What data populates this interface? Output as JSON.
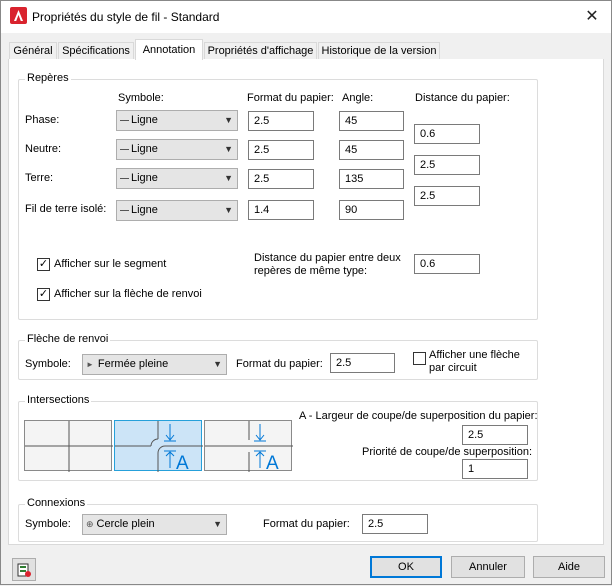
{
  "window": {
    "title": "Propriétés du style de fil - Standard",
    "close_glyph": "✕"
  },
  "tabs": [
    {
      "label": "Général"
    },
    {
      "label": "Spécifications"
    },
    {
      "label": "Annotation"
    },
    {
      "label": "Propriétés d'affichage"
    },
    {
      "label": "Historique de la version"
    }
  ],
  "reperes": {
    "group_label": "Repères",
    "col_symbole": "Symbole:",
    "col_format": "Format du papier:",
    "col_angle": "Angle:",
    "col_distance": "Distance du papier:",
    "rows": [
      {
        "label": "Phase:",
        "symbole": "Ligne",
        "format": "2.5",
        "angle": "45",
        "distance": "0.6"
      },
      {
        "label": "Neutre:",
        "symbole": "Ligne",
        "format": "2.5",
        "angle": "45",
        "distance": "2.5"
      },
      {
        "label": "Terre:",
        "symbole": "Ligne",
        "format": "2.5",
        "angle": "135",
        "distance": "2.5"
      },
      {
        "label": "Fil de terre isolé:",
        "symbole": "Ligne",
        "format": "1.4",
        "angle": "90"
      }
    ],
    "afficher_segment": "Afficher sur le segment",
    "afficher_fleche": "Afficher sur la flèche de renvoi",
    "distance_deux_l1": "Distance du papier entre deux",
    "distance_deux_l2": "repères de même type:",
    "distance_deux_value": "0.6"
  },
  "fleche": {
    "group_label": "Flèche de renvoi",
    "symbole_label": "Symbole:",
    "symbole_value": "Fermée pleine",
    "format_label": "Format du papier:",
    "format_value": "2.5",
    "afficher_l1": "Afficher une flèche",
    "afficher_l2": "par circuit"
  },
  "intersections": {
    "group_label": "Intersections",
    "largeur_label": "A - Largeur de coupe/de superposition du papier:",
    "largeur_value": "2.5",
    "priorite_label": "Priorité de coupe/de superposition:",
    "priorite_value": "1",
    "letter_a": "A"
  },
  "connexions": {
    "group_label": "Connexions",
    "symbole_label": "Symbole:",
    "symbole_value": "Cercle plein",
    "format_label": "Format du papier:",
    "format_value": "2.5"
  },
  "buttons": {
    "ok": "OK",
    "annuler": "Annuler",
    "aide": "Aide"
  },
  "colors": {
    "accent": "#0078d7",
    "selected_bg": "#cce4f7",
    "app_red": "#d9232e"
  }
}
